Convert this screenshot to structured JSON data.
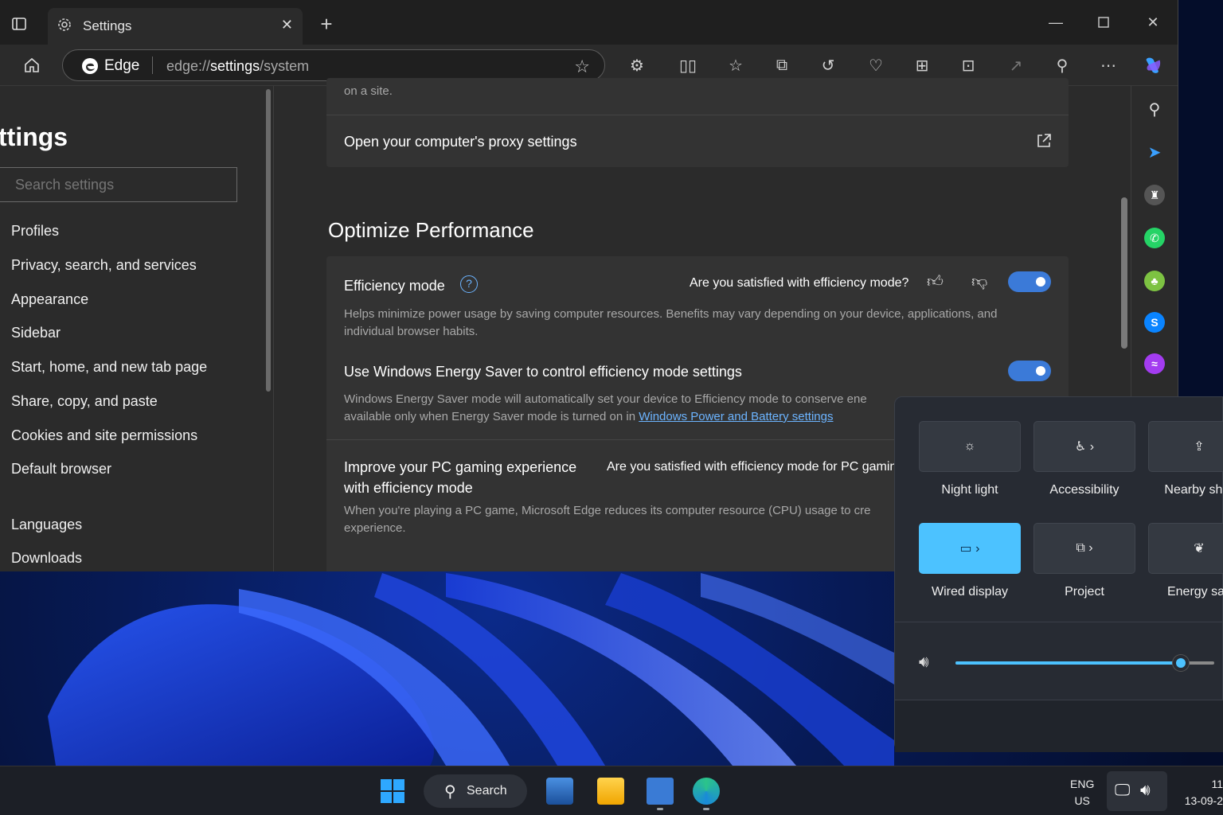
{
  "browser": {
    "tab_title": "Settings",
    "address_brand": "Edge",
    "address_url_prefix": "edge://",
    "address_url_bold": "settings",
    "address_url_suffix": "/system"
  },
  "nav": {
    "heading": "ttings",
    "search_placeholder": "Search settings",
    "items": [
      "Profiles",
      "Privacy, search, and services",
      "Appearance",
      "Sidebar",
      "Start, home, and new tab page",
      "Share, copy, and paste",
      "Cookies and site permissions",
      "Default browser",
      "Languages",
      "Downloads"
    ]
  },
  "main": {
    "cutoff_text": "on a site.",
    "proxy_label": "Open your computer's proxy settings",
    "section_title": "Optimize Performance",
    "efficiency": {
      "title": "Efficiency mode",
      "question": "Are you satisfied with efficiency mode?",
      "desc_line1": "Helps minimize power usage by saving computer resources. Benefits may vary depending on your device, applications, and",
      "desc_line2": "individual browser habits.",
      "enabled": true
    },
    "energy_saver": {
      "title": "Use Windows Energy Saver to control efficiency mode settings",
      "desc_line1": "Windows Energy Saver mode will automatically set your device to Efficiency mode to conserve ene",
      "desc_line2_prefix": "available only when Energy Saver mode is turned on in ",
      "desc_link": "Windows Power and Battery settings",
      "enabled": true
    },
    "gaming": {
      "title_line1": "Improve your PC gaming experience",
      "title_line2": "with efficiency mode",
      "question": "Are you satisfied with efficiency mode for PC gamin",
      "desc_line1": "When you're playing a PC game, Microsoft Edge reduces its computer resource (CPU) usage to cre",
      "desc_line2": "experience."
    }
  },
  "quick_settings": {
    "tiles": [
      {
        "label": "Night light",
        "icon": "brightness-icon",
        "active": false
      },
      {
        "label": "Accessibility",
        "icon": "accessibility-icon",
        "active": false
      },
      {
        "label": "Nearby shar",
        "icon": "share-icon",
        "active": false
      },
      {
        "label": "Wired display",
        "icon": "cast-icon",
        "active": true
      },
      {
        "label": "Project",
        "icon": "project-icon",
        "active": false
      },
      {
        "label": "Energy sav",
        "icon": "leaf-icon",
        "active": false
      }
    ],
    "volume_level": 0.87
  },
  "taskbar": {
    "search_label": "Search",
    "lang_line1": "ENG",
    "lang_line2": "US",
    "time": "11",
    "date": "13-09-2"
  },
  "colors": {
    "accent": "#3b7ad8",
    "quick_active": "#4cc2ff",
    "link": "#6cb4ff"
  }
}
